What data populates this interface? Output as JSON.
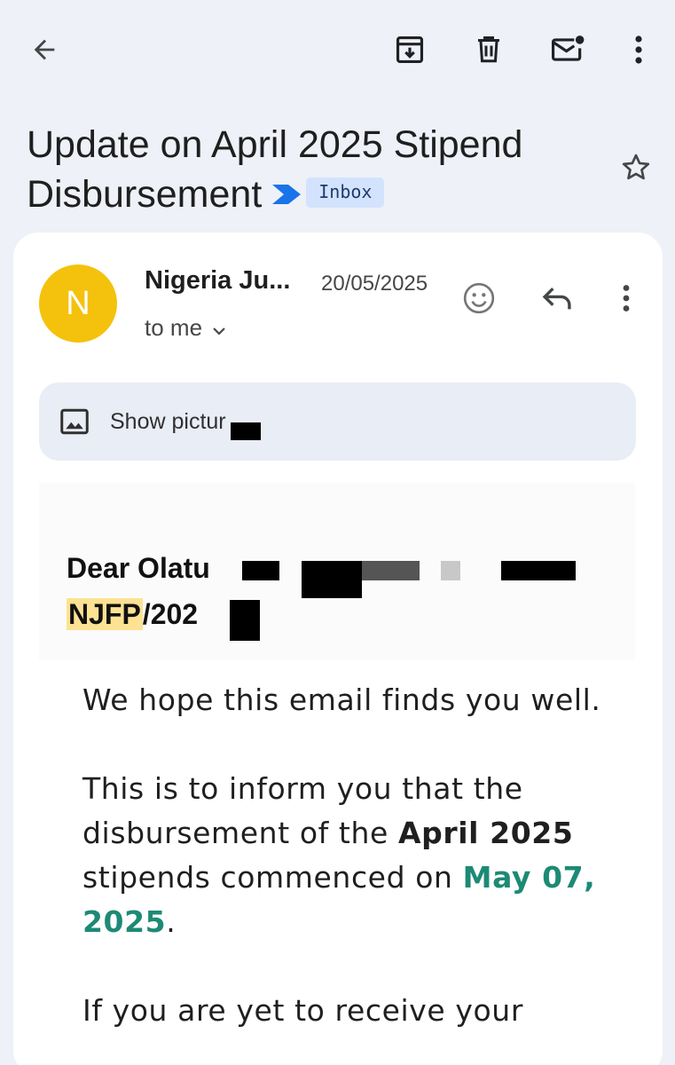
{
  "toolbar": {
    "back_icon": "arrow-left-icon",
    "archive_icon": "archive-icon",
    "delete_icon": "trash-icon",
    "mark_unread_icon": "mail-unread-icon",
    "more_icon": "more-vert-icon"
  },
  "email": {
    "subject": "Update on April 2025 Stipend Disbursement",
    "label_chip": "Inbox",
    "sender": "Nigeria Ju...",
    "avatar_letter": "N",
    "date": "20/05/2025",
    "recipient": "to me",
    "show_pictures": "Show pictur",
    "greeting_start": "Dear Olatu",
    "greeting_ref_highlight": "NJFP",
    "greeting_ref_rest": "/202",
    "body": {
      "line1": "We hope this email finds you well.",
      "p2_start": "This is to inform you that the disbursement of the ",
      "p2_bold": "April 2025",
      "p2_mid": " stipends commenced on ",
      "p2_date": "May 07, 2025",
      "p2_end": ".",
      "p3_partial": "If you are yet to receive your"
    }
  },
  "colors": {
    "background": "#eef1f7",
    "avatar": "#f4c20d",
    "chip_bg": "#d3e3fd",
    "importance_marker": "#1a73e8",
    "highlight": "#fde293",
    "date_accent": "#1d8a75"
  }
}
